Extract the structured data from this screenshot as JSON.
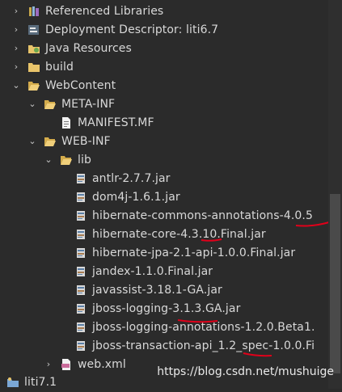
{
  "tree": {
    "items": [
      {
        "label": "Referenced Libraries",
        "icon": "library-icon",
        "expanded": false
      },
      {
        "label": "Deployment Descriptor: liti6.7",
        "icon": "deployment-descriptor-icon",
        "expanded": false
      },
      {
        "label": "Java Resources",
        "icon": "java-resources-icon",
        "expanded": false
      },
      {
        "label": "build",
        "icon": "folder-icon",
        "expanded": false
      },
      {
        "label": "WebContent",
        "icon": "folder-icon",
        "expanded": true
      },
      {
        "label": "META-INF",
        "icon": "folder-icon",
        "expanded": true
      },
      {
        "label": "MANIFEST.MF",
        "icon": "manifest-file-icon"
      },
      {
        "label": "WEB-INF",
        "icon": "folder-icon",
        "expanded": true
      },
      {
        "label": "lib",
        "icon": "folder-icon",
        "expanded": true
      },
      {
        "label": "antlr-2.7.7.jar",
        "icon": "jar-icon"
      },
      {
        "label": "dom4j-1.6.1.jar",
        "icon": "jar-icon"
      },
      {
        "label": "hibernate-commons-annotations-4.0.5",
        "icon": "jar-icon"
      },
      {
        "label": "hibernate-core-4.3.10.Final.jar",
        "icon": "jar-icon"
      },
      {
        "label": "hibernate-jpa-2.1-api-1.0.0.Final.jar",
        "icon": "jar-icon"
      },
      {
        "label": "jandex-1.1.0.Final.jar",
        "icon": "jar-icon"
      },
      {
        "label": "javassist-3.18.1-GA.jar",
        "icon": "jar-icon"
      },
      {
        "label": "jboss-logging-3.1.3.GA.jar",
        "icon": "jar-icon"
      },
      {
        "label": "jboss-logging-annotations-1.2.0.Beta1.",
        "icon": "jar-icon"
      },
      {
        "label": "jboss-transaction-api_1.2_spec-1.0.0.Fi",
        "icon": "jar-icon"
      },
      {
        "label": "web.xml",
        "icon": "xml-file-icon",
        "expanded": false
      },
      {
        "label": "liti7.1",
        "icon": "project-icon"
      }
    ]
  },
  "watermark": "https://blog.csdn.net/mushuige",
  "colors": {
    "background": "#2b2b2b",
    "text": "#d8d8d8",
    "annotation_red": "#e0001a",
    "folder": "#e8c46a"
  }
}
